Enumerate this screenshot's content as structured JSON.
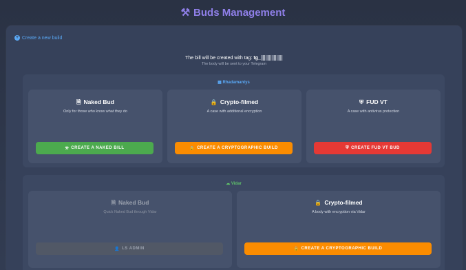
{
  "header": {
    "icon": "hammer-icon",
    "title": "Buds Management"
  },
  "panel": {
    "create_link": "Create a new build",
    "tag_label": "The bill will be created with tag:",
    "tag_value": "tg_",
    "tag_sub": "The body will be sent to your Telegram"
  },
  "groups": [
    {
      "title": "Rhadamantys",
      "icon": "windows-icon",
      "color": "#5aa8f5",
      "cards": [
        {
          "title": "Naked Bud",
          "icon": "file-icon",
          "desc": "Only for those who know what they do",
          "button": "CREATE A NAKED BILL",
          "button_icon": "hammer-icon",
          "button_color": "#4caa4e"
        },
        {
          "title": "Crypto-filmed",
          "icon": "lock-icon",
          "desc": "A case with additional encryption",
          "button": "CREATE A CRYPTOGRAPHIC BUILD",
          "button_icon": "lock-icon",
          "button_color": "#fb8c00"
        },
        {
          "title": "FUD VT",
          "icon": "shield-icon",
          "desc": "A case with antivirus protection",
          "button": "CREATE FUD VT BUD",
          "button_icon": "shield-icon",
          "button_color": "#e53935"
        }
      ]
    },
    {
      "title": "Vidar",
      "icon": "cloud-icon",
      "color": "#5fc26a",
      "cards": [
        {
          "title": "Naked Bud",
          "icon": "file-icon",
          "desc": "Quick Naked Bud through Vidar",
          "button": "LS ADMIN",
          "button_icon": "user-lock-icon",
          "disabled": true
        },
        {
          "title": "Crypto-filmed",
          "icon": "lock-icon",
          "desc": "A body with encryption via Vidar",
          "button": "CREATE A CRYPTOGRAPHIC BUILD",
          "button_icon": "lock-icon",
          "button_color": "#fb8c00"
        }
      ]
    }
  ]
}
